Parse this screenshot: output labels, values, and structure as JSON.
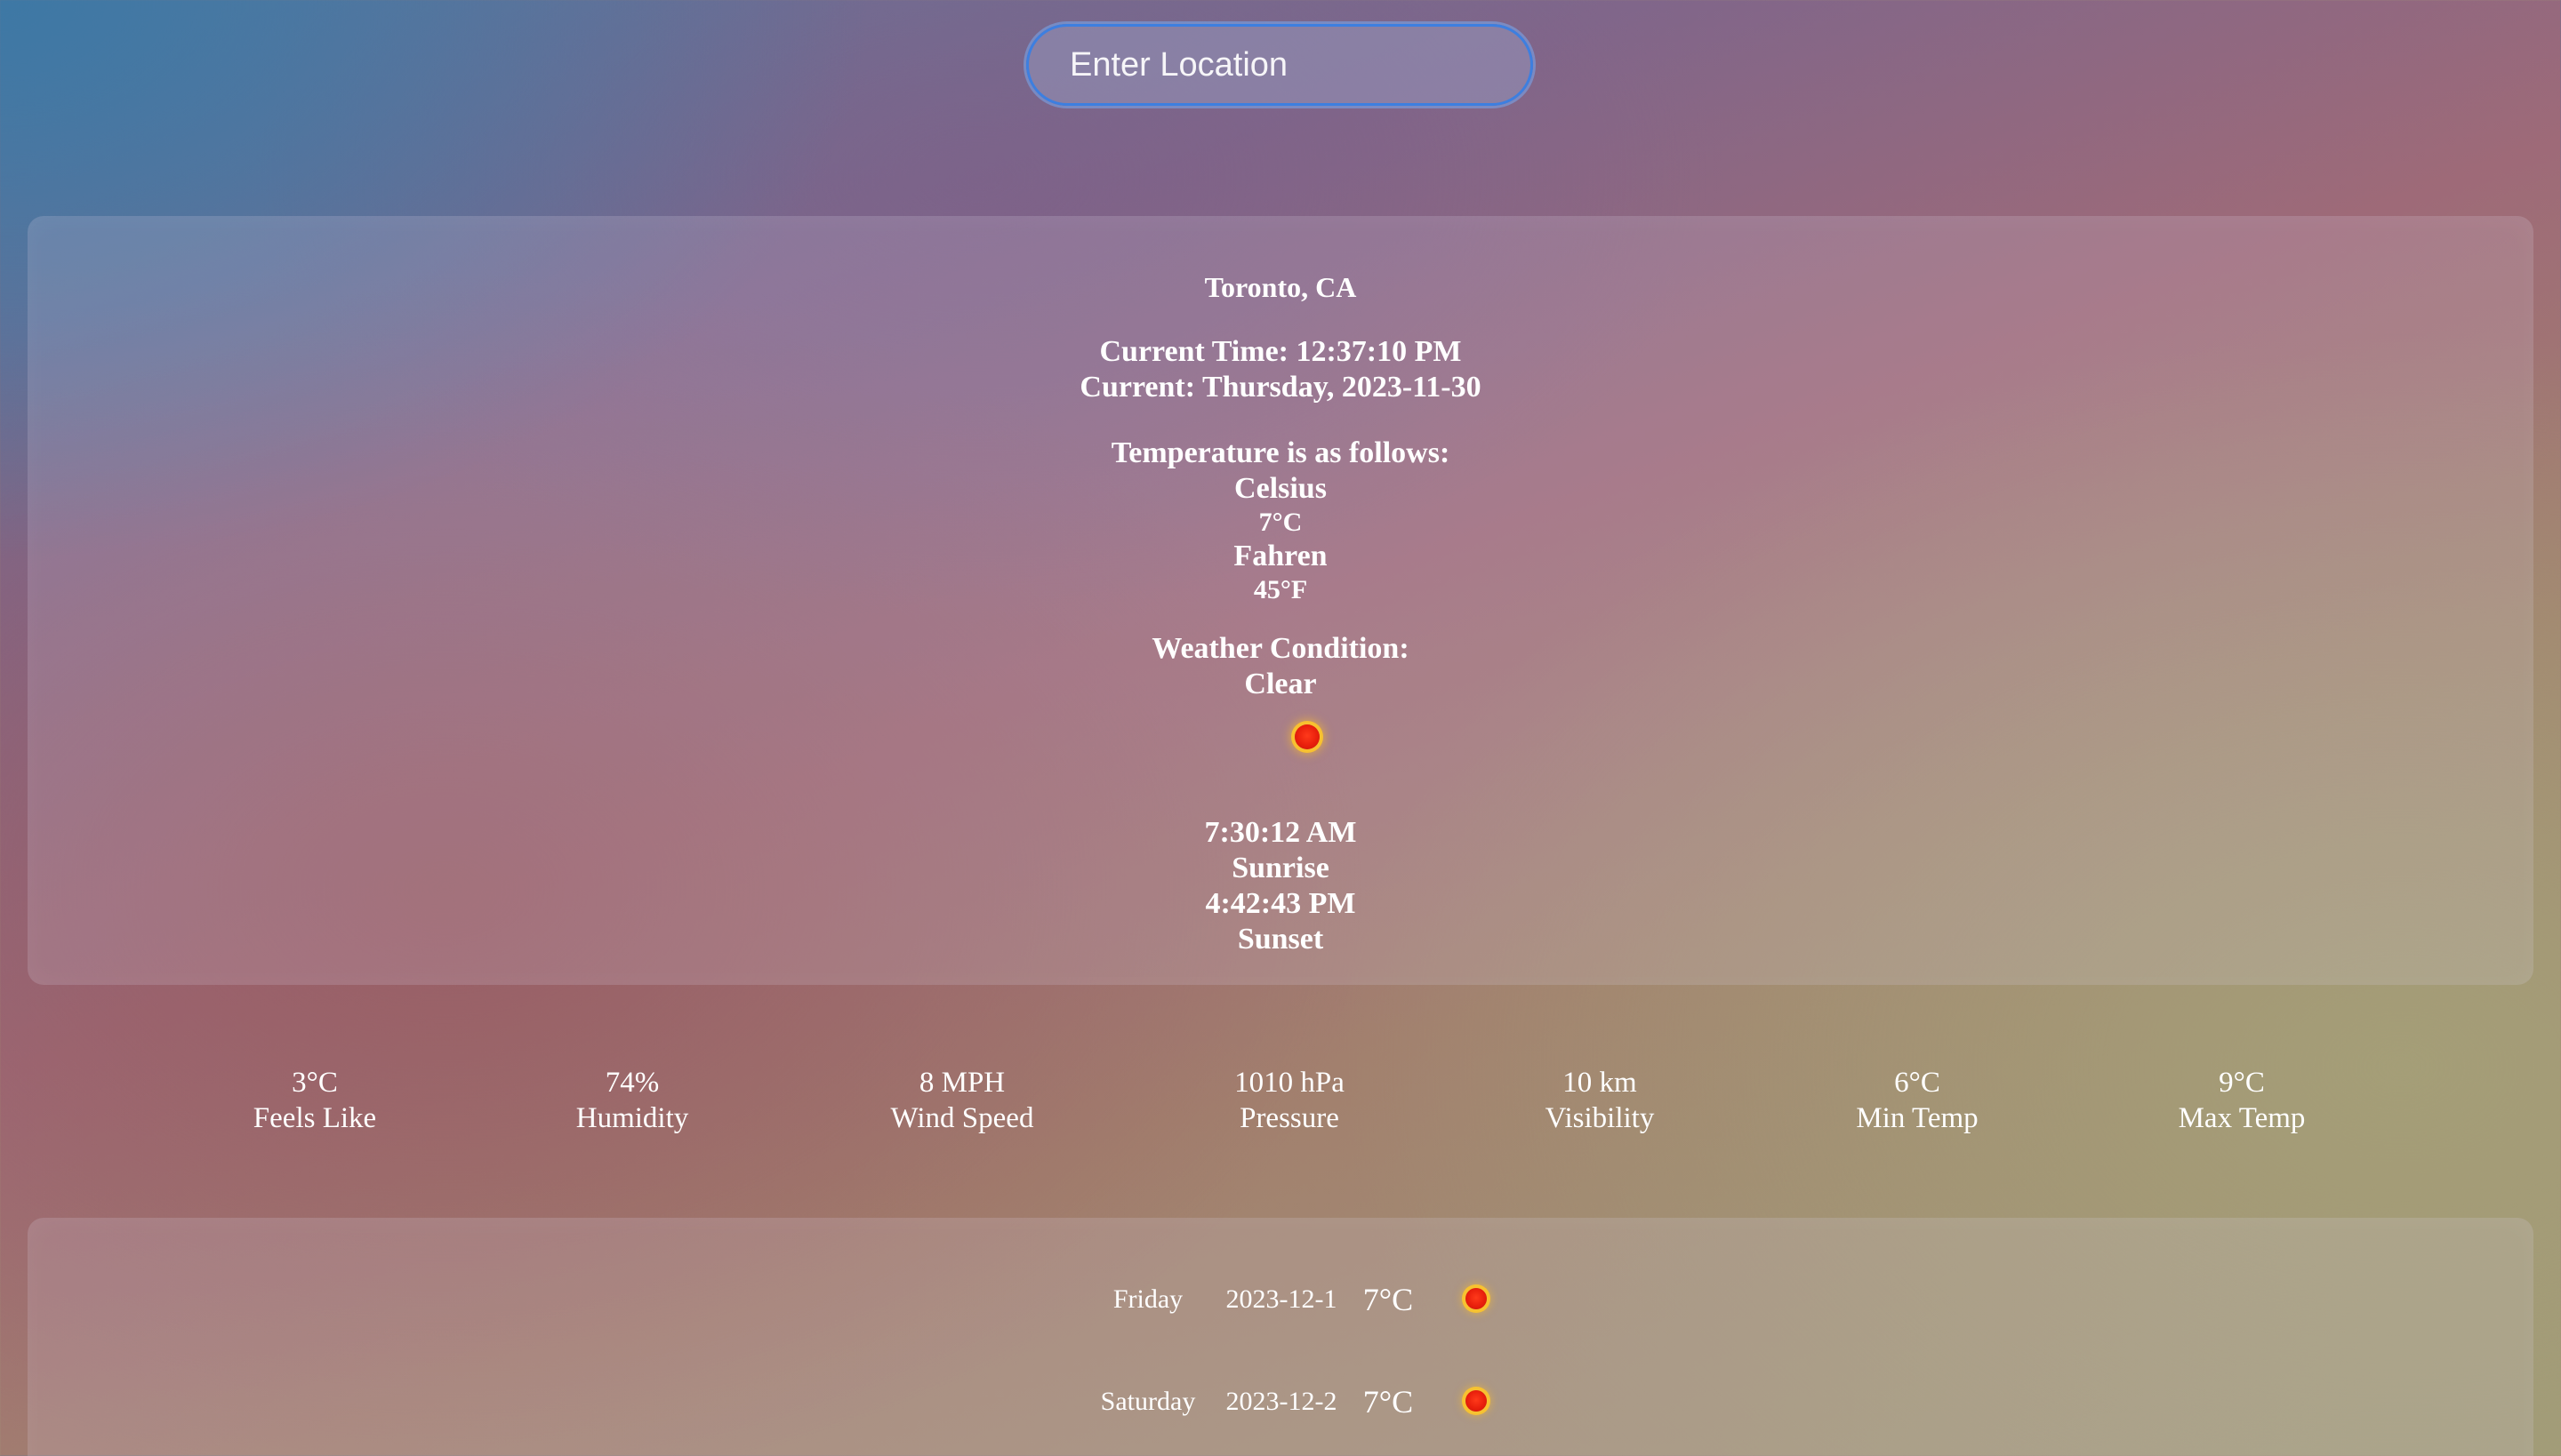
{
  "search": {
    "placeholder": "Enter Location",
    "value": ""
  },
  "current": {
    "location": "Toronto, CA",
    "time_line": "Current Time: 12:37:10 PM",
    "date_line": "Current: Thursday, 2023-11-30",
    "temp_heading": "Temperature is as follows:",
    "celsius_label": "Celsius",
    "celsius_value": "7°C",
    "fahren_label": "Fahren",
    "fahren_value": "45°F",
    "condition_heading": "Weather Condition:",
    "condition": "Clear",
    "condition_icon": "sun-icon",
    "sunrise_time": "7:30:12 AM",
    "sunrise_label": "Sunrise",
    "sunset_time": "4:42:43 PM",
    "sunset_label": "Sunset"
  },
  "stats": [
    {
      "value": "3°C",
      "label": "Feels Like"
    },
    {
      "value": "74%",
      "label": "Humidity"
    },
    {
      "value": "8 MPH",
      "label": "Wind Speed"
    },
    {
      "value": "1010 hPa",
      "label": "Pressure"
    },
    {
      "value": "10 km",
      "label": "Visibility"
    },
    {
      "value": "6°C",
      "label": "Min Temp"
    },
    {
      "value": "9°C",
      "label": "Max Temp"
    }
  ],
  "forecast": [
    {
      "day": "Friday",
      "date": "2023-12-1",
      "temp": "7°C",
      "icon": "sun-icon"
    },
    {
      "day": "Saturday",
      "date": "2023-12-2",
      "temp": "7°C",
      "icon": "sun-icon"
    }
  ],
  "colors": {
    "input_focus_ring": "#3d7fe0",
    "sun_core": "#e81f0c",
    "sun_glow": "#ffc828"
  }
}
